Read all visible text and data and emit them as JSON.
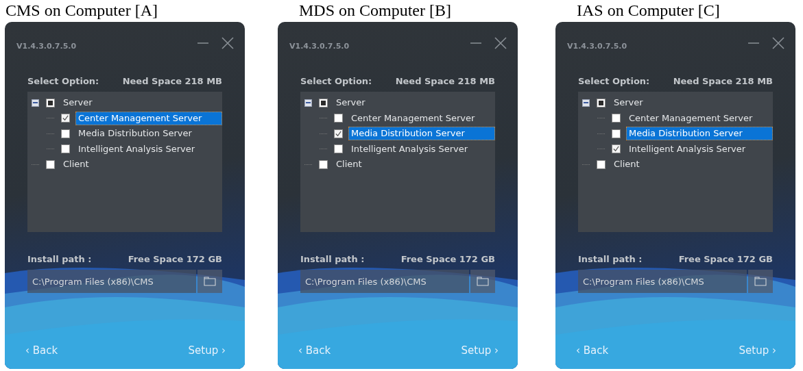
{
  "panels": [
    {
      "caption": "CMS on Computer [A]",
      "window": {
        "version": "V1.4.3.0.7.5.0",
        "select_label": "Select Option:",
        "need_space": "Need Space 218 MB",
        "tree": [
          {
            "label": "Server",
            "checked": false,
            "partial": true,
            "expanded": true,
            "selected": false,
            "children": [
              {
                "label": "Center Management Server",
                "checked": true,
                "partial": false,
                "selected": true
              },
              {
                "label": "Media Distribution Server",
                "checked": false,
                "partial": false,
                "selected": false
              },
              {
                "label": "Intelligent Analysis Server",
                "checked": false,
                "partial": false,
                "selected": false
              }
            ]
          },
          {
            "label": "Client",
            "checked": false,
            "partial": false,
            "selected": false
          }
        ],
        "install_label": "Install path :",
        "free_space": "Free Space 172 GB",
        "path": "C:\\Program Files (x86)\\CMS",
        "back": "‹ Back",
        "setup": "Setup ›"
      }
    },
    {
      "caption": "MDS on Computer [B]",
      "window": {
        "version": "V1.4.3.0.7.5.0",
        "select_label": "Select Option:",
        "need_space": "Need Space 218 MB",
        "tree": [
          {
            "label": "Server",
            "checked": false,
            "partial": true,
            "expanded": true,
            "selected": false,
            "children": [
              {
                "label": "Center Management Server",
                "checked": false,
                "partial": false,
                "selected": false
              },
              {
                "label": "Media Distribution Server",
                "checked": true,
                "partial": false,
                "selected": true
              },
              {
                "label": "Intelligent Analysis Server",
                "checked": false,
                "partial": false,
                "selected": false
              }
            ]
          },
          {
            "label": "Client",
            "checked": false,
            "partial": false,
            "selected": false
          }
        ],
        "install_label": "Install path :",
        "free_space": "Free Space 172 GB",
        "path": "C:\\Program Files (x86)\\CMS",
        "back": "‹ Back",
        "setup": "Setup ›"
      }
    },
    {
      "caption": "IAS on Computer [C]",
      "window": {
        "version": "V1.4.3.0.7.5.0",
        "select_label": "Select Option:",
        "need_space": "Need Space 218 MB",
        "tree": [
          {
            "label": "Server",
            "checked": false,
            "partial": true,
            "expanded": true,
            "selected": false,
            "children": [
              {
                "label": "Center Management Server",
                "checked": false,
                "partial": false,
                "selected": false
              },
              {
                "label": "Media Distribution Server",
                "checked": false,
                "partial": false,
                "selected": true
              },
              {
                "label": "Intelligent Analysis Server",
                "checked": true,
                "partial": false,
                "selected": false
              }
            ]
          },
          {
            "label": "Client",
            "checked": false,
            "partial": false,
            "selected": false
          }
        ],
        "install_label": "Install path :",
        "free_space": "Free Space 172 GB",
        "path": "C:\\Program Files (x86)\\CMS",
        "back": "‹ Back",
        "setup": "Setup ›"
      }
    }
  ]
}
